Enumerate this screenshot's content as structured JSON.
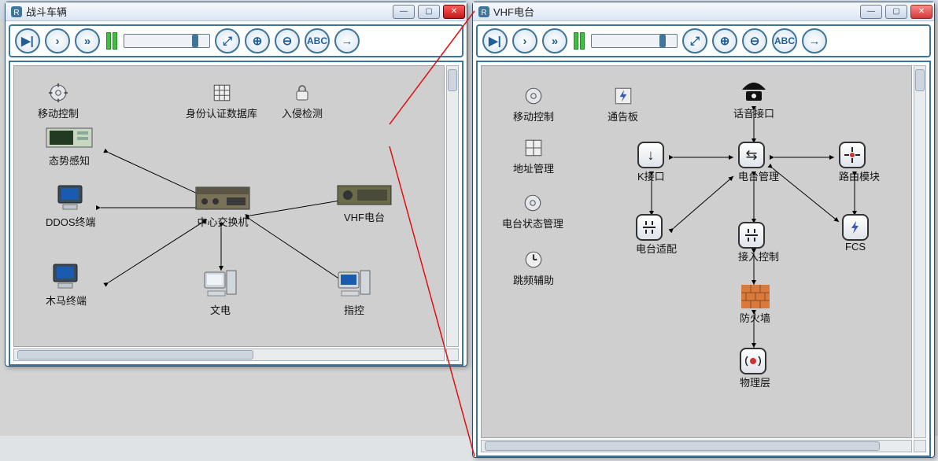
{
  "windows": {
    "left": {
      "title": "战斗车辆",
      "toolbar": {
        "abc": "ABC"
      },
      "winbtns": {
        "min": "—",
        "max": "▢",
        "close": "✕"
      },
      "nodes": {
        "mobileCtrl": "移动控制",
        "authDb": "身份认证数据库",
        "ids": "入侵检测",
        "situation": "态势感知",
        "ddos": "DDOS终端",
        "trojan": "木马终端",
        "switch": "中心交换机",
        "wendian": "文电",
        "zhikong": "指控",
        "vhf": "VHF电台"
      }
    },
    "right": {
      "title": "VHF电台",
      "toolbar": {
        "abc": "ABC"
      },
      "winbtns": {
        "min": "—",
        "max": "▢",
        "close": "✕"
      },
      "nodes": {
        "mobileCtrl": "移动控制",
        "notice": "通告板",
        "voice": "话音接口",
        "addrMgr": "地址管理",
        "kif": "K接口",
        "radioMgr": "电台管理",
        "routeMod": "路由模块",
        "radioState": "电台状态管理",
        "radioAdapt": "电台适配",
        "access": "接入控制",
        "fcs": "FCS",
        "hopAssist": "跳频辅助",
        "firewall": "防火墙",
        "phy": "物理层"
      }
    }
  }
}
